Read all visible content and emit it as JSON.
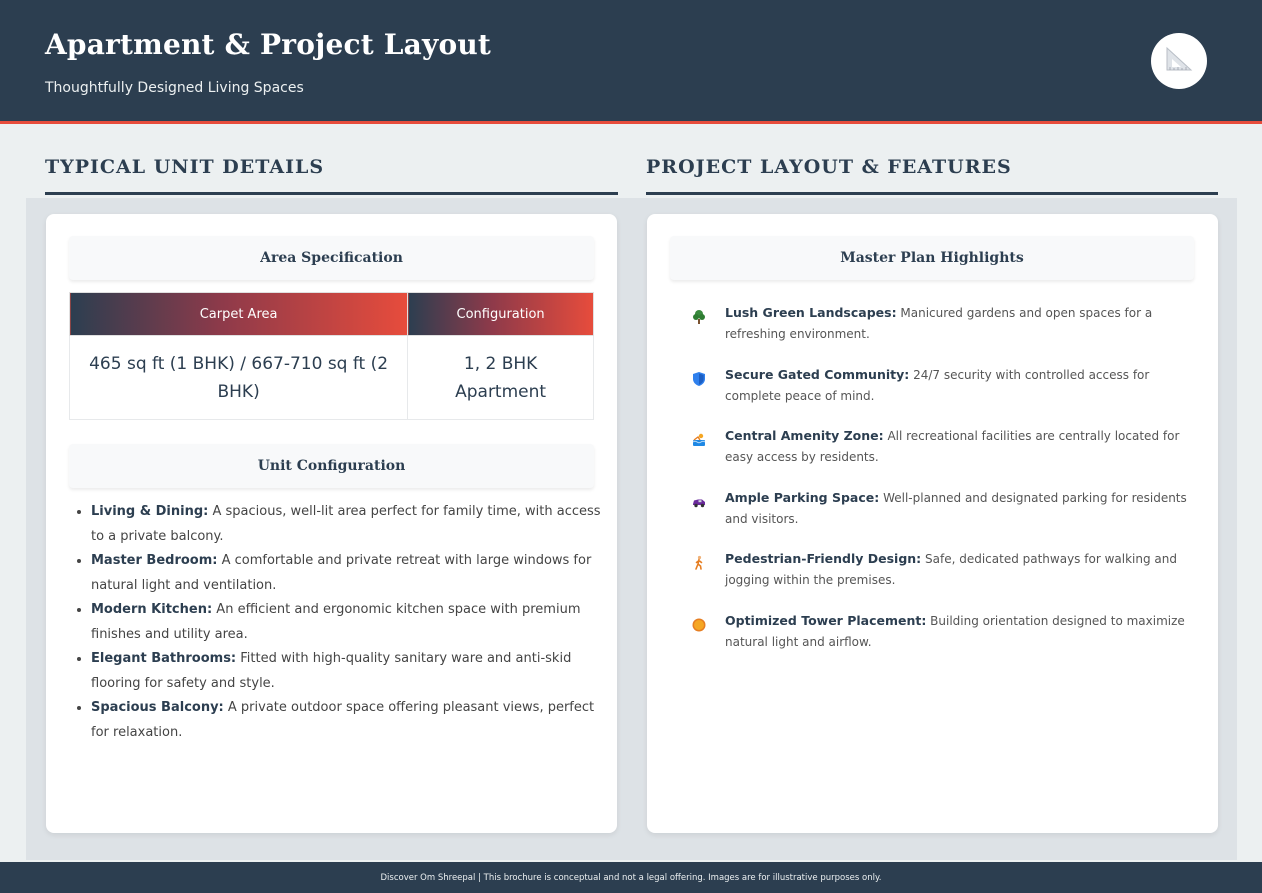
{
  "header": {
    "title": "Apartment & Project Layout",
    "subtitle": "Thoughtfully Designed Living Spaces",
    "logo_icon": "set-square-icon"
  },
  "left": {
    "section_title": "TYPICAL UNIT DETAILS",
    "area_heading": "Area Specification",
    "table": {
      "headers": [
        "Carpet Area",
        "Configuration"
      ],
      "row": [
        "465 sq ft (1 BHK) / 667-710 sq ft (2 BHK)",
        "1, 2 BHK Apartment"
      ]
    },
    "config_heading": "Unit Configuration",
    "units": [
      {
        "label": "Living & Dining:",
        "text": " A spacious, well-lit area perfect for family time, with access to a private balcony."
      },
      {
        "label": "Master Bedroom:",
        "text": " A comfortable and private retreat with large windows for natural light and ventilation."
      },
      {
        "label": "Modern Kitchen:",
        "text": " An efficient and ergonomic kitchen space with premium finishes and utility area."
      },
      {
        "label": "Elegant Bathrooms:",
        "text": " Fitted with high-quality sanitary ware and anti-skid flooring for safety and style."
      },
      {
        "label": "Spacious Balcony:",
        "text": " A private outdoor space offering pleasant views, perfect for relaxation."
      }
    ]
  },
  "right": {
    "section_title": "PROJECT LAYOUT & FEATURES",
    "heading": "Master Plan Highlights",
    "features": [
      {
        "icon": "tree-icon",
        "label": "Lush Green Landscapes:",
        "text": " Manicured gardens and open spaces for a refreshing environment."
      },
      {
        "icon": "shield-icon",
        "label": "Secure Gated Community:",
        "text": " 24/7 security with controlled access for complete peace of mind."
      },
      {
        "icon": "pool-icon",
        "label": "Central Amenity Zone:",
        "text": " All recreational facilities are centrally located for easy access by residents."
      },
      {
        "icon": "car-icon",
        "label": "Ample Parking Space:",
        "text": " Well-planned and designated parking for residents and visitors."
      },
      {
        "icon": "walking-person-icon",
        "label": "Pedestrian-Friendly Design:",
        "text": " Safe, dedicated pathways for walking and jogging within the premises."
      },
      {
        "icon": "sun-icon",
        "label": "Optimized Tower Placement:",
        "text": " Building orientation designed to maximize natural light and airflow."
      }
    ]
  },
  "footer": {
    "text": "Discover Om Shreepal | This brochure is conceptual and not a legal offering. Images are for illustrative purposes only."
  },
  "colors": {
    "primary": "#2c3e50",
    "accent": "#e74c3c",
    "background": "#ecf0f1"
  }
}
